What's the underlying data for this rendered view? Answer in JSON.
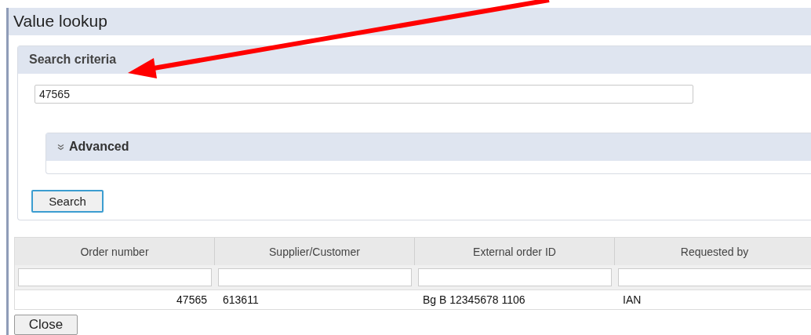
{
  "window": {
    "title": "Value lookup"
  },
  "search_criteria": {
    "title": "Search criteria",
    "value": "47565",
    "advanced": {
      "label": "Advanced",
      "expanded": false
    },
    "button": "Search"
  },
  "table": {
    "columns": [
      "Order number",
      "Supplier/Customer",
      "External order ID",
      "Requested by"
    ],
    "rows": [
      [
        "47565",
        "613611",
        "Bg B 12345678 1106",
        "IAN"
      ]
    ]
  },
  "buttons": [
    "Close"
  ]
}
